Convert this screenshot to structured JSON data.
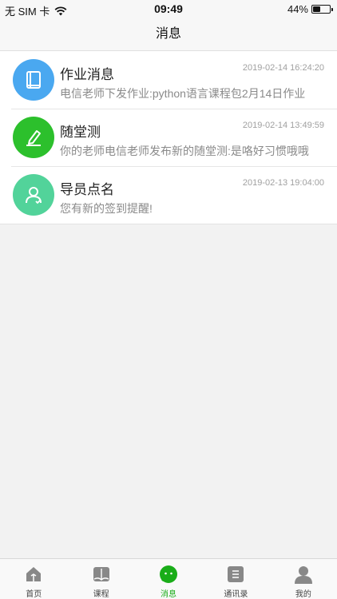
{
  "status": {
    "carrier": "无 SIM 卡",
    "time": "09:49",
    "battery": "44%",
    "battery_level": 0.44
  },
  "nav": {
    "title": "消息"
  },
  "messages": [
    {
      "title": "作业消息",
      "time": "2019-02-14 16:24:20",
      "preview": "电信老师下发作业:python语言课程包2月14日作业",
      "icon": "book-icon",
      "color": "#4aa8f0"
    },
    {
      "title": "随堂测",
      "time": "2019-02-14 13:49:59",
      "preview": "你的老师电信老师发布新的随堂测:是咯好习惯哦哦",
      "icon": "pencil-icon",
      "color": "#2cc02c"
    },
    {
      "title": "导员点名",
      "time": "2019-02-13 19:04:00",
      "preview": "您有新的签到提醒!",
      "icon": "person-icon",
      "color": "#52d39a"
    }
  ],
  "tabs": [
    {
      "label": "首页",
      "icon": "home-icon",
      "active": false
    },
    {
      "label": "课程",
      "icon": "course-book-icon",
      "active": false
    },
    {
      "label": "消息",
      "icon": "chat-icon",
      "active": true
    },
    {
      "label": "通讯录",
      "icon": "contacts-icon",
      "active": false
    },
    {
      "label": "我的",
      "icon": "profile-icon",
      "active": false
    }
  ],
  "colors": {
    "accent": "#1aad19",
    "tab_inactive": "#888888"
  }
}
